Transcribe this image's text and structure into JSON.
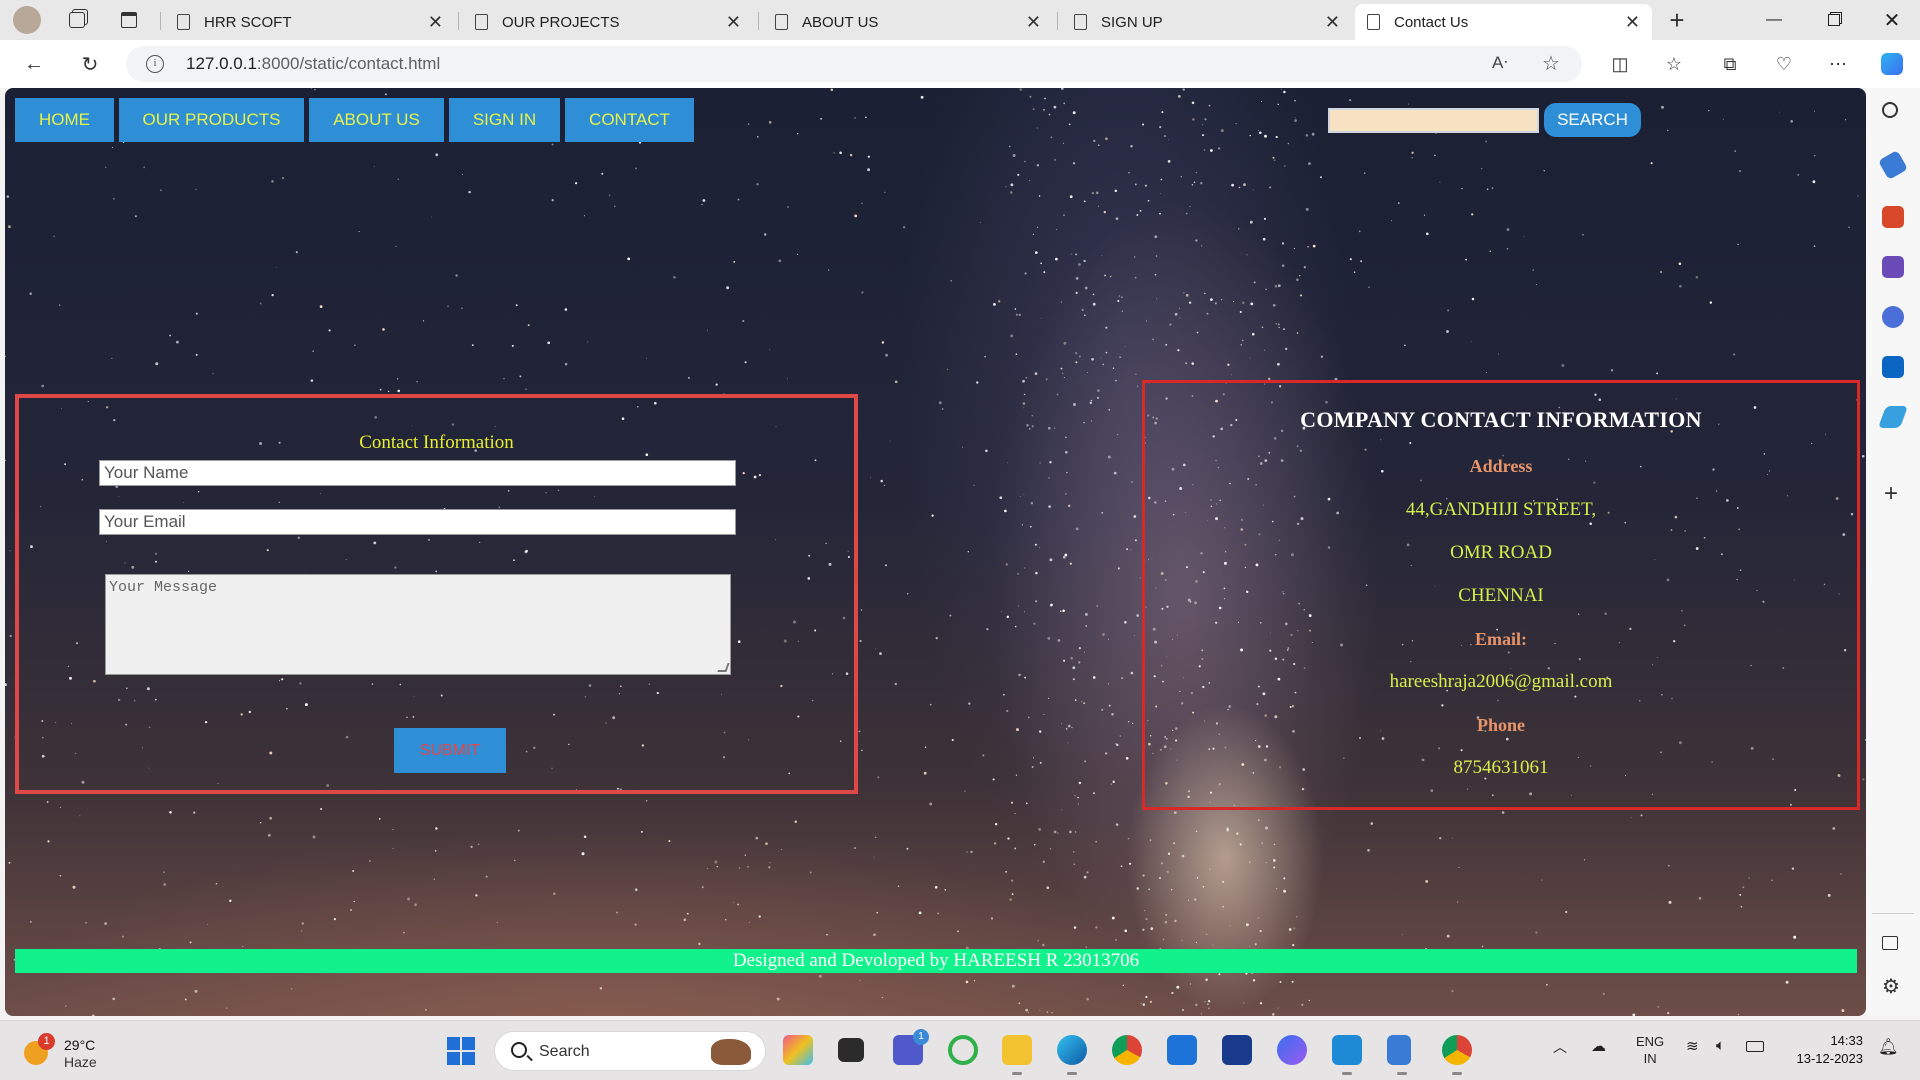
{
  "browser": {
    "tabs": [
      {
        "title": "HRR SCOFT",
        "active": false
      },
      {
        "title": "OUR PROJECTS",
        "active": false
      },
      {
        "title": "ABOUT US",
        "active": false
      },
      {
        "title": "SIGN UP",
        "active": false
      },
      {
        "title": "Contact Us",
        "active": true
      }
    ],
    "url_host": "127.0.0.1",
    "url_rest": ":8000/static/contact.html"
  },
  "page": {
    "nav": [
      {
        "label": "HOME"
      },
      {
        "label": "OUR PRODUCTS"
      },
      {
        "label": "ABOUT US"
      },
      {
        "label": "SIGN IN"
      },
      {
        "label": "CONTACT"
      }
    ],
    "search_button": "SEARCH",
    "search_value": "",
    "form": {
      "title": "Contact Information",
      "name_placeholder": "Your Name",
      "email_placeholder": "Your Email",
      "message_placeholder": "Your Message",
      "submit": "SUBMIT"
    },
    "company": {
      "title": "COMPANY CONTACT INFORMATION",
      "address_label": "Address",
      "address_line1": "44,GANDHIJI STREET,",
      "address_line2": "OMR ROAD",
      "address_line3": "CHENNAI",
      "email_label": "Email:",
      "email": "hareeshraja2006@gmail.com",
      "phone_label": "Phone",
      "phone": "8754631061"
    },
    "footer": "Designed and Devoloped by HAREESH R 23013706"
  },
  "taskbar": {
    "weather_temp": "29°C",
    "weather_cond": "Haze",
    "weather_badge": "1",
    "search_label": "Search",
    "lang_top": "ENG",
    "lang_bottom": "IN",
    "time": "14:33",
    "date": "13-12-2023",
    "teams_badge": "1"
  },
  "colors": {
    "nav_bg": "#2e8fd6",
    "nav_text": "#e8f24a",
    "form_border": "#e04848",
    "company_border": "#d82828",
    "footer_bg": "#12f28c"
  }
}
